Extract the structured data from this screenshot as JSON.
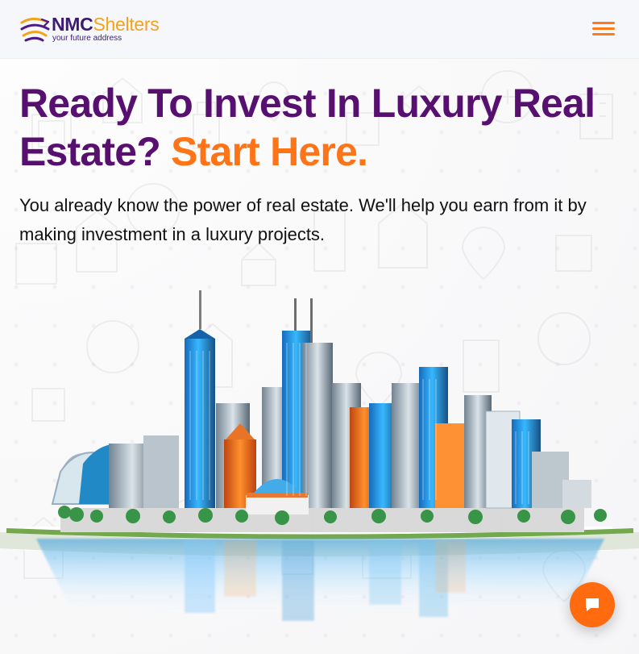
{
  "brand": {
    "name_primary": "NMC",
    "name_secondary": "Shelters",
    "tagline": "your future address"
  },
  "header": {
    "menu_icon": "hamburger-menu-icon"
  },
  "hero": {
    "heading_line": "Ready To Invest In Luxury Real Estate?",
    "heading_accent": "Start Here.",
    "description": "You already know the power of real estate. We'll help you earn from it by making investment in a luxury projects."
  },
  "illustration": {
    "subject": "luxury city skyline on an island"
  },
  "chat": {
    "icon": "chat-icon"
  },
  "colors": {
    "brand_purple": "#57106F",
    "brand_orange": "#FF7417",
    "logo_gold": "#F3A21C",
    "chat_orange": "#FF6B0E"
  }
}
